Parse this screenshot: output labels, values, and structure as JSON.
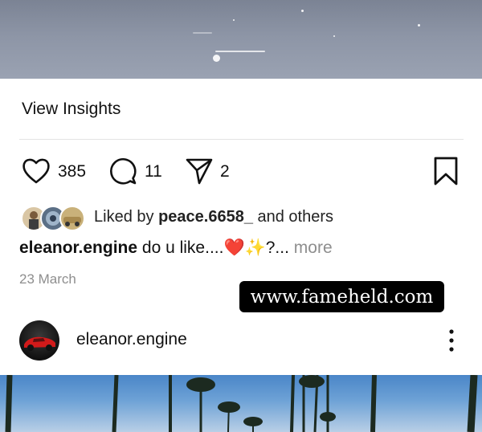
{
  "top_photo": {
    "alt": "previous post photo"
  },
  "insights": {
    "label": "View Insights"
  },
  "actions": {
    "like_count": "385",
    "comment_count": "11",
    "share_count": "2"
  },
  "liked_by": {
    "prefix": "Liked by ",
    "user": "peace.6658_",
    "suffix": " and others"
  },
  "caption": {
    "username": "eleanor.engine",
    "text": " do u like....",
    "emoji": "❤️✨",
    "tail": "?... ",
    "more": "more"
  },
  "date": "23 March",
  "watermark": "www.fameheld.com",
  "next_post": {
    "username": "eleanor.engine"
  },
  "colors": {
    "text": "#111111",
    "muted": "#8e8e8e",
    "divider": "#e3e3e3",
    "heart": "#e5202b"
  },
  "icons": [
    "heart-icon",
    "comment-icon",
    "share-icon",
    "bookmark-icon",
    "more-options-icon"
  ]
}
